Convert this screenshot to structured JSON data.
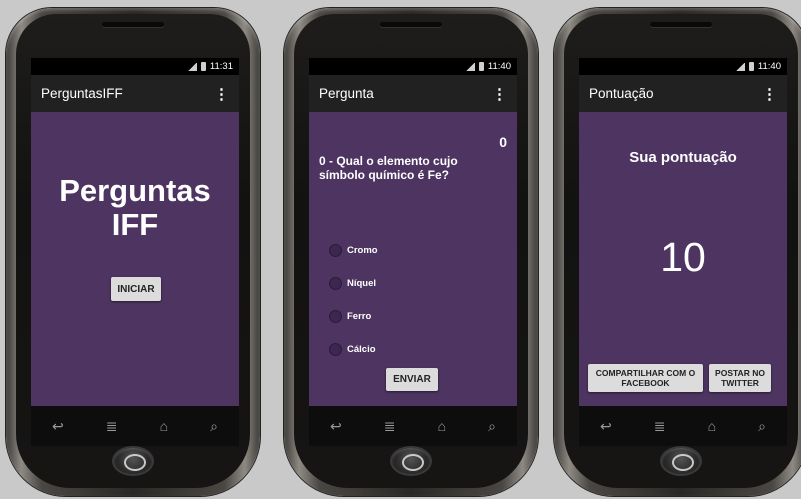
{
  "status_times": [
    "11:31",
    "11:40",
    "11:40"
  ],
  "screen1": {
    "actionbar_title": "PerguntasIFF",
    "title_line1": "Perguntas",
    "title_line2": "IFF",
    "start_button": "INICIAR"
  },
  "screen2": {
    "actionbar_title": "Pergunta",
    "score": "0",
    "question": "0 - Qual o elemento cujo símbolo químico é Fe?",
    "options": [
      "Cromo",
      "Níquel",
      "Ferro",
      "Cálcio"
    ],
    "submit_button": "ENVIAR"
  },
  "screen3": {
    "actionbar_title": "Pontuação",
    "score_label": "Sua pontuação",
    "score_value": "10",
    "share_facebook": "COMPARTILHAR COM O FACEBOOK",
    "post_twitter": "POSTAR NO TWITTER"
  },
  "icons": {
    "overflow": "overflow-menu-icon",
    "nav": [
      "back-icon",
      "menu-icon",
      "home-icon",
      "search-icon"
    ]
  },
  "colors": {
    "content_bg": "#4d3461",
    "actionbar_bg": "#212121",
    "button_bg": "#dcdcdc"
  }
}
